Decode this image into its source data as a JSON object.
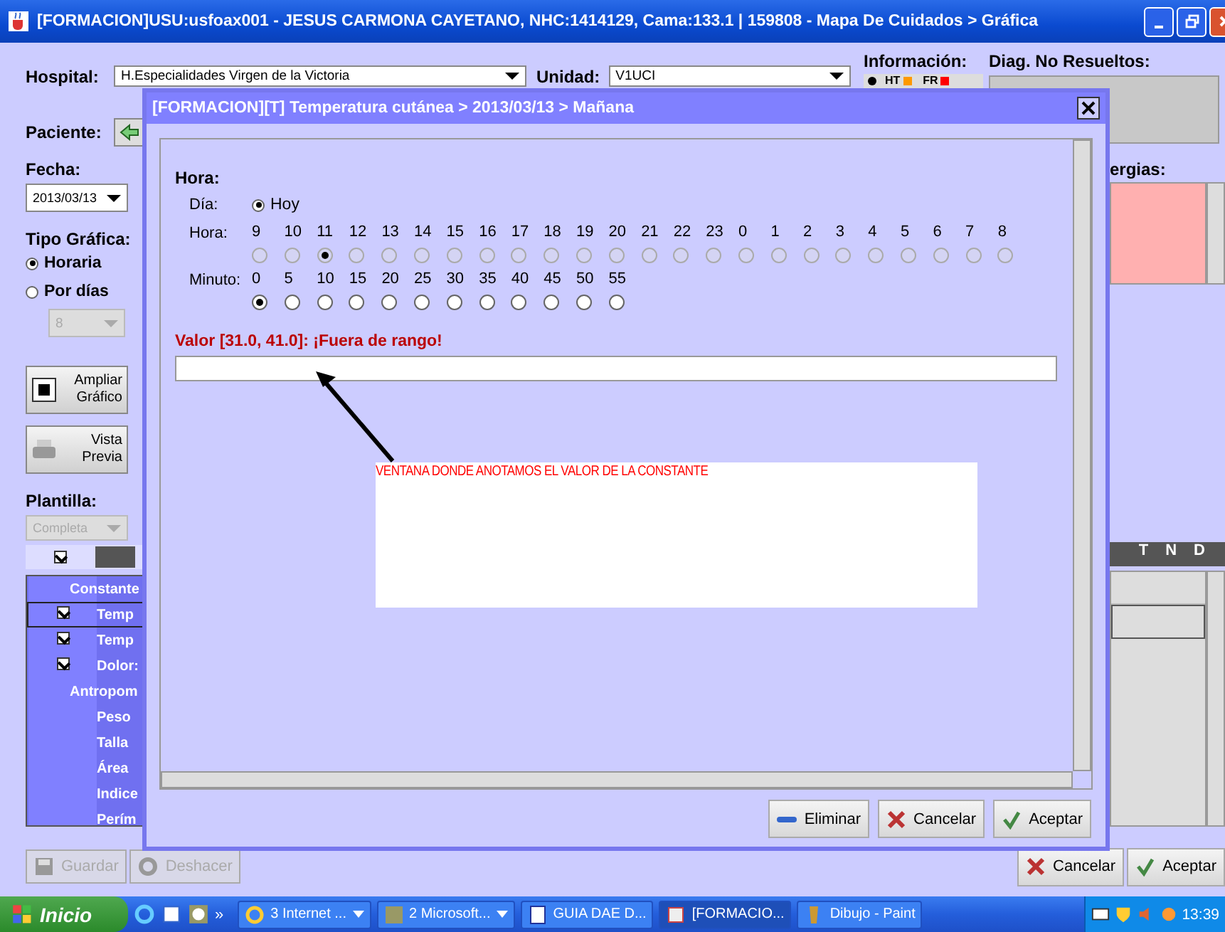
{
  "window": {
    "title": "[FORMACION]USU:usfoax001 - JESUS CARMONA CAYETANO, NHC:1414129, Cama:133.1 | 159808 - Mapa De Cuidados > Gráfica"
  },
  "header": {
    "hospital_label": "Hospital:",
    "hospital_value": "H.Especialidades Virgen de la Victoria",
    "unidad_label": "Unidad:",
    "unidad_value": "V1UCI",
    "paciente_label": "Paciente:",
    "info_label": "Información:",
    "info_legend": [
      {
        "label": "HT",
        "color": "#ff9900"
      },
      {
        "label": "FR",
        "color": "#ff0000"
      }
    ],
    "diag_label": "Diag. No Resueltos:"
  },
  "left": {
    "fecha_label": "Fecha:",
    "fecha_value": "2013/03/13",
    "tipo_label": "Tipo Gráfica:",
    "tipo_options": [
      {
        "label": "Horaria",
        "selected": true
      },
      {
        "label": "Por días",
        "selected": false
      }
    ],
    "dias_value": "8",
    "buttons": [
      {
        "kind": "zoom",
        "label": "Ampliar Gráfico"
      },
      {
        "kind": "print",
        "label": "Vista Previa"
      }
    ],
    "plantilla_label": "Plantilla:",
    "plantilla_value": "Completa",
    "header_checked": true,
    "rows": [
      {
        "kind": "group",
        "label": "Constante"
      },
      {
        "kind": "item",
        "label": "Temp",
        "checked": true,
        "selected": true
      },
      {
        "kind": "item",
        "label": "Temp",
        "checked": true,
        "selected": false
      },
      {
        "kind": "item",
        "label": "Dolor:",
        "checked": true,
        "selected": false
      },
      {
        "kind": "group",
        "label": "Antropom"
      },
      {
        "kind": "item",
        "label": "Peso",
        "checked": false,
        "selected": false
      },
      {
        "kind": "item",
        "label": "Talla",
        "checked": false,
        "selected": false
      },
      {
        "kind": "item",
        "label": "Área",
        "checked": false,
        "selected": false
      },
      {
        "kind": "item",
        "label": "Indice",
        "checked": false,
        "selected": false
      },
      {
        "kind": "item",
        "label": "Perím",
        "checked": false,
        "selected": false
      }
    ]
  },
  "right": {
    "alergias_label": "ergias:",
    "table_headers": [
      "T",
      "N",
      "D"
    ]
  },
  "bottom_left": [
    {
      "kind": "save",
      "label": "Guardar",
      "disabled": true
    },
    {
      "kind": "undo",
      "label": "Deshacer",
      "disabled": true
    }
  ],
  "bottom_right": [
    {
      "kind": "cancel",
      "label": "Cancelar"
    },
    {
      "kind": "accept",
      "label": "Aceptar"
    }
  ],
  "dialog": {
    "title": "[FORMACION][T] Temperatura cutánea > 2013/03/13 > Mañana",
    "section_label": "Hora:",
    "dia_label": "Día:",
    "dia_options": [
      {
        "label": "Hoy",
        "selected": true
      }
    ],
    "hora_label": "Hora:",
    "hours": {
      "disabled": true,
      "items": [
        {
          "label": "9",
          "selected": false
        },
        {
          "label": "10",
          "selected": false
        },
        {
          "label": "11",
          "selected": true
        },
        {
          "label": "12",
          "selected": false
        },
        {
          "label": "13",
          "selected": false
        },
        {
          "label": "14",
          "selected": false
        },
        {
          "label": "15",
          "selected": false
        },
        {
          "label": "16",
          "selected": false
        },
        {
          "label": "17",
          "selected": false
        },
        {
          "label": "18",
          "selected": false
        },
        {
          "label": "19",
          "selected": false
        },
        {
          "label": "20",
          "selected": false
        },
        {
          "label": "21",
          "selected": false
        },
        {
          "label": "22",
          "selected": false
        },
        {
          "label": "23",
          "selected": false
        },
        {
          "label": "0",
          "selected": false
        },
        {
          "label": "1",
          "selected": false
        },
        {
          "label": "2",
          "selected": false
        },
        {
          "label": "3",
          "selected": false
        },
        {
          "label": "4",
          "selected": false
        },
        {
          "label": "5",
          "selected": false
        },
        {
          "label": "6",
          "selected": false
        },
        {
          "label": "7",
          "selected": false
        },
        {
          "label": "8",
          "selected": false
        }
      ]
    },
    "minuto_label": "Minuto:",
    "minutes": {
      "disabled": false,
      "items": [
        {
          "label": "0",
          "selected": true
        },
        {
          "label": "5",
          "selected": false
        },
        {
          "label": "10",
          "selected": false
        },
        {
          "label": "15",
          "selected": false
        },
        {
          "label": "20",
          "selected": false
        },
        {
          "label": "25",
          "selected": false
        },
        {
          "label": "30",
          "selected": false
        },
        {
          "label": "35",
          "selected": false
        },
        {
          "label": "40",
          "selected": false
        },
        {
          "label": "45",
          "selected": false
        },
        {
          "label": "50",
          "selected": false
        },
        {
          "label": "55",
          "selected": false
        }
      ]
    },
    "value_message": "Valor [31.0, 41.0]: ¡Fuera de rango!",
    "annotation": "VENTANA DONDE ANOTAMOS EL VALOR DE LA CONSTANTE",
    "buttons": [
      {
        "kind": "delete",
        "label": "Eliminar"
      },
      {
        "kind": "cancel",
        "label": "Cancelar"
      },
      {
        "kind": "accept",
        "label": "Aceptar"
      }
    ]
  },
  "taskbar": {
    "start": "Inicio",
    "more": "»",
    "tasks": [
      {
        "kind": "browser",
        "label": "3 Internet ...",
        "menu": true,
        "selected": false
      },
      {
        "kind": "clock",
        "label": "2 Microsoft...",
        "menu": true,
        "selected": false
      },
      {
        "kind": "document",
        "label": "GUIA DAE D...",
        "menu": false,
        "selected": false
      },
      {
        "kind": "java",
        "label": "[FORMACIO...",
        "menu": false,
        "selected": true
      },
      {
        "kind": "paint",
        "label": "Dibujo - Paint",
        "menu": false,
        "selected": false
      }
    ],
    "clock": "13:39"
  }
}
